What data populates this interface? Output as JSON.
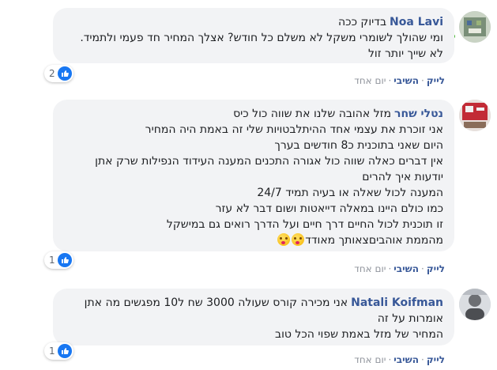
{
  "comments": [
    {
      "author": "Noa Lavi",
      "lines": [
        "בדיוק ככה",
        "ומי שהולך לשומרי משקל לא משלם כל חודש? אצלך המחיר חד פעמי ולתמיד.",
        "לא שייך יותר זול"
      ],
      "reaction_icon": "like-icon",
      "reaction_count": "2",
      "like_label": "לייק",
      "reply_label": "השיבי",
      "time": "יום אחד"
    },
    {
      "author": "נטלי שחר",
      "lines": [
        "מזל אהובה שלנו את שווה כול כיס",
        "אני זוכרת את עצמי אחד ההיתלבטויות שלי זה באמת היה המחיר",
        "היום שאני בתוכנית כ8 חודשים בערך",
        "אין דברים כאלה שווה כול אגורה התכנים המענה העידוד הנפילות שרק אתן",
        "יודעות איך להרים",
        "המענה לכול שאלה או בעיה תמיד 24/7",
        "כמו כולם היינו במאלה דייאטות ושום דבר לא עזר",
        "זו תוכנית לכול החיים דרך חיים ועל הדרך רואים גם במישקל",
        "מהממת אוהבים‌צאותך מאודד"
      ],
      "emojis": [
        "kissing-heart-emoji",
        "kissing-heart-emoji"
      ],
      "reaction_icon": "like-icon",
      "reaction_count": "1",
      "like_label": "לייק",
      "reply_label": "השיבי",
      "time": "יום אחד"
    },
    {
      "author": "Natali Koifman",
      "lines": [
        "אני מכירה קורס שעולה 3000 שח ל10 מפגשים מה אתן",
        "אומרות על זה",
        "המחיר של מזל באמת שפוי הכל טוב"
      ],
      "reaction_icon": "like-icon",
      "reaction_count": "1",
      "like_label": "לייק",
      "reply_label": "השיבי",
      "time": "יום אחד"
    }
  ],
  "colors": {
    "bubble": "#f2f3f5",
    "author": "#385898",
    "like": "#1877f2",
    "online": "#42b72a",
    "muted": "#90949c"
  }
}
